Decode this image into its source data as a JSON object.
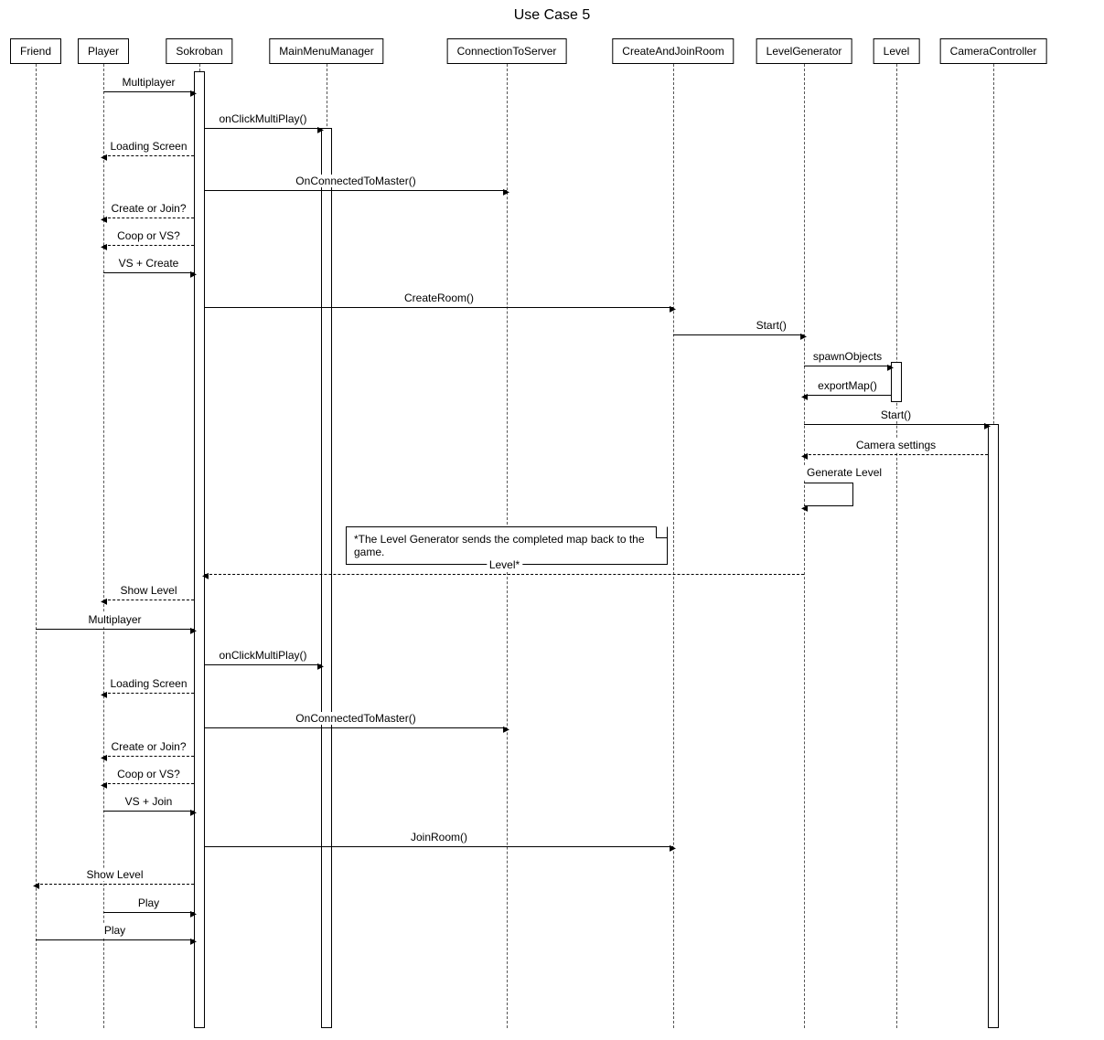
{
  "title": "Use Case 5",
  "participants": {
    "friend": "Friend",
    "player": "Player",
    "sokroban": "Sokroban",
    "mainmenu": "MainMenuManager",
    "connection": "ConnectionToServer",
    "room": "CreateAndJoinRoom",
    "levelgen": "LevelGenerator",
    "level": "Level",
    "camera": "CameraController"
  },
  "messages": {
    "m1": "Multiplayer",
    "m2": "onClickMultiPlay()",
    "m3": "Loading Screen",
    "m4": "OnConnectedToMaster()",
    "m5": "Create or Join?",
    "m6": "Coop or VS?",
    "m7": "VS + Create",
    "m8": "CreateRoom()",
    "m9": "Start()",
    "m10": "spawnObjects",
    "m11": "exportMap()",
    "m12": "Start()",
    "m13": "Camera settings",
    "m14": "Generate Level",
    "m15": "Level*",
    "m16": "Show Level",
    "m17": "Multiplayer",
    "m18": "onClickMultiPlay()",
    "m19": "Loading Screen",
    "m20": "OnConnectedToMaster()",
    "m21": "Create or Join?",
    "m22": "Coop or VS?",
    "m23": "VS + Join",
    "m24": "JoinRoom()",
    "m25": "Show Level",
    "m26": "Play",
    "m27": "Play"
  },
  "note": "*The Level Generator sends the completed map back to the game."
}
